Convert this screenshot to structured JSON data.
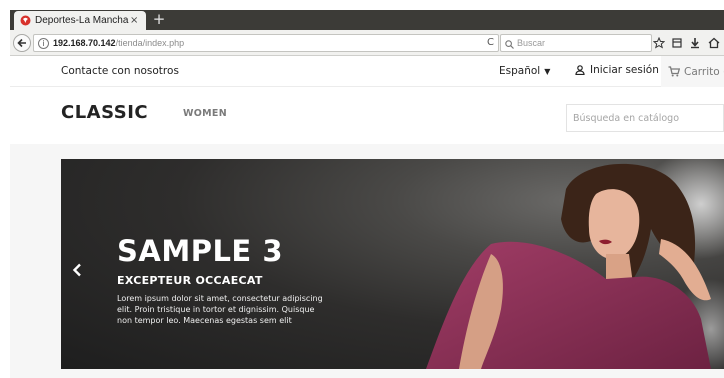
{
  "browser": {
    "tab_title": "Deportes-La Mancha",
    "tab_close": "×",
    "new_tab": "+",
    "url_host": "192.168.70.142",
    "url_path": "/tienda/index.php",
    "search_placeholder": "Buscar",
    "reload": "C"
  },
  "store": {
    "contact": "Contacte con nosotros",
    "language": "Español",
    "signin": "Iniciar sesión",
    "cart": "Carrito (",
    "logo": "CLASSIC",
    "menu": [
      "WOMEN"
    ],
    "catalog_search_placeholder": "Búsqueda en catálogo"
  },
  "slider": {
    "title": "SAMPLE 3",
    "subtitle": "EXCEPTEUR OCCAECAT",
    "text": "Lorem ipsum dolor sit amet, consectetur adipiscing elit. Proin tristique in tortor et dignissim. Quisque non tempor leo. Maecenas egestas sem elit"
  },
  "colors": {
    "tab_strip": "#3c3b37",
    "toolbar": "#f1f1ef",
    "text_dark": "#232323",
    "text_muted": "#7a7a7a",
    "content_bg": "#f6f6f6",
    "dress": "#8e3358"
  },
  "icons": {
    "favicon": "favicon-icon",
    "back": "back-arrow-icon",
    "info": "info-icon",
    "search": "search-icon",
    "bookmark": "star-icon",
    "library": "library-icon",
    "download": "download-icon",
    "home": "home-icon",
    "user": "user-icon",
    "cart": "cart-icon",
    "slider_prev": "chevron-left-icon"
  }
}
